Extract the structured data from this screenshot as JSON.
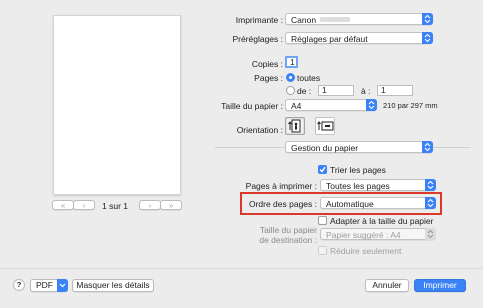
{
  "colors": {
    "accent": "#3b82f6",
    "highlight_box": "#d9382a"
  },
  "preview": {
    "page_counter": "1 sur 1"
  },
  "printer": {
    "label": "Imprimante :",
    "value": "Canon"
  },
  "presets": {
    "label": "Préréglages :",
    "value": "Réglages par défaut"
  },
  "copies": {
    "label": "Copies :",
    "value": "1"
  },
  "pages": {
    "label": "Pages :",
    "all_label": "toutes",
    "from_label": "de :",
    "from_value": "1",
    "to_label": "à :",
    "to_value": "1",
    "selected": "toutes"
  },
  "paper_size": {
    "label": "Taille du papier :",
    "value": "A4",
    "dimensions": "210 par 297 mm"
  },
  "orientation": {
    "label": "Orientation :",
    "portrait_icon": "portrait-orientation-icon",
    "landscape_icon": "landscape-orientation-icon"
  },
  "section_menu": {
    "value": "Gestion du papier"
  },
  "collate": {
    "label": "Trier les pages",
    "checked": true
  },
  "pages_to_print": {
    "label": "Pages à imprimer :",
    "value": "Toutes les pages"
  },
  "page_order": {
    "label": "Ordre des pages :",
    "value": "Automatique"
  },
  "scale_to_fit": {
    "label": "Adapter à la taille du papier",
    "checked": false
  },
  "destination_size": {
    "label_line1": "Taille du papier",
    "label_line2": "de destination :",
    "value": "Papier suggéré : A4"
  },
  "scale_down_only": {
    "label": "Réduire seulement",
    "checked": false
  },
  "footer": {
    "help_symbol": "?",
    "pdf_label": "PDF",
    "details_label": "Masquer les détails",
    "cancel_label": "Annuler",
    "print_label": "Imprimer"
  }
}
